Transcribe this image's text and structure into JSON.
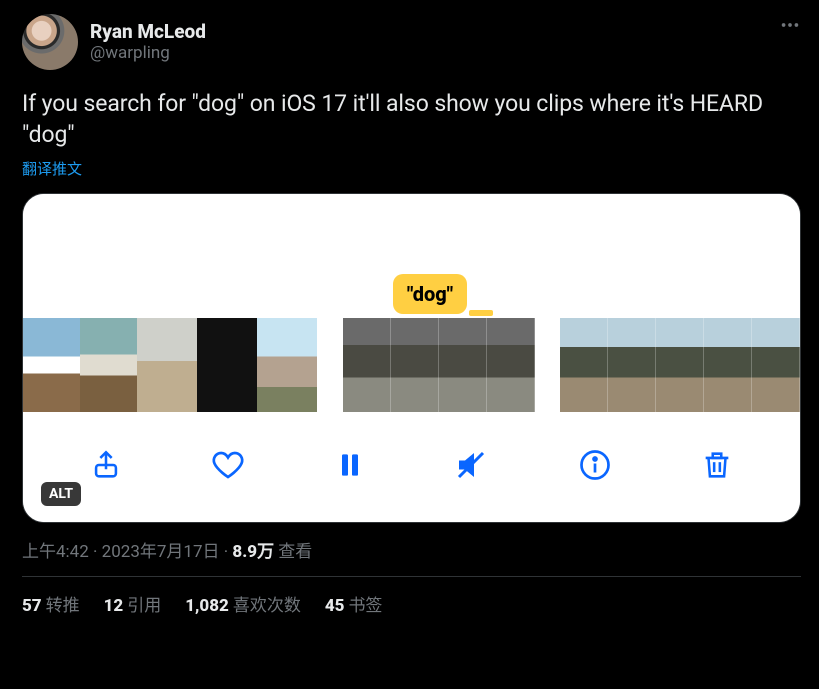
{
  "author": {
    "display_name": "Ryan McLeod",
    "handle": "@warpling"
  },
  "tweet_text": "If you search for \"dog\" on iOS 17 it'll also show you clips where it's HEARD \"dog\"",
  "translate_label": "翻译推文",
  "media": {
    "badge_text": "\"dog\"",
    "alt_label": "ALT",
    "toolbar_icons": [
      "share",
      "like",
      "pause",
      "mute",
      "info",
      "delete"
    ]
  },
  "meta": {
    "time": "上午4:42",
    "date": "2023年7月17日",
    "views_value": "8.9万",
    "views_label": "查看"
  },
  "stats": {
    "retweets_value": "57",
    "retweets_label": "转推",
    "quotes_value": "12",
    "quotes_label": "引用",
    "likes_value": "1,082",
    "likes_label": "喜欢次数",
    "bookmarks_value": "45",
    "bookmarks_label": "书签"
  }
}
